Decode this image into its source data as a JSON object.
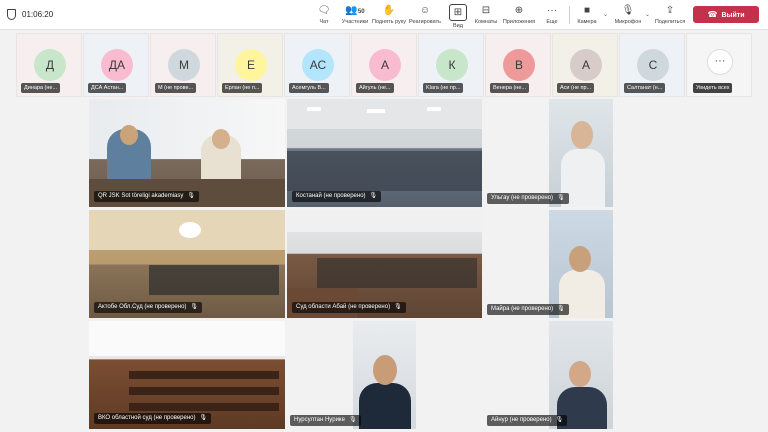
{
  "toolbar": {
    "timer": "01:06:20",
    "chat_label": "Чат",
    "participants_label": "Участники",
    "participants_count": "50",
    "raise_hand_label": "Поднять руку",
    "react_label": "Реагировать",
    "view_label": "Вид",
    "rooms_label": "Комнаты",
    "apps_label": "Приложения",
    "more_label": "Еще",
    "camera_label": "Камера",
    "mic_label": "Микрофон",
    "share_label": "Поделиться",
    "leave_label": "Выйти"
  },
  "strip": [
    {
      "initials": "Д",
      "name": "Динара (не...",
      "color": "#c8e6c9"
    },
    {
      "initials": "ДА",
      "name": "ДСА Астан...",
      "color": "#f8bbd0"
    },
    {
      "initials": "М",
      "name": "М (не прове...",
      "color": "#cfd8dc"
    },
    {
      "initials": "Е",
      "name": "Ерлан (не п...",
      "color": "#fff59d"
    },
    {
      "initials": "АС",
      "name": "Асемгуль В...",
      "color": "#b3e5fc"
    },
    {
      "initials": "А",
      "name": "Айгуль (не...",
      "color": "#f8bbd0"
    },
    {
      "initials": "К",
      "name": "Klara (не пр...",
      "color": "#c8e6c9"
    },
    {
      "initials": "В",
      "name": "Венера (не...",
      "color": "#ef9a9a"
    },
    {
      "initials": "А",
      "name": "Аси (не пр...",
      "color": "#d7ccc8"
    },
    {
      "initials": "С",
      "name": "Салтанат (н...",
      "color": "#cfd8dc"
    }
  ],
  "see_all_label": "Увидеть всех",
  "tiles": {
    "t1": "QR JSK Sot töreligi akademiasy",
    "t2": "Костанай (не проверено)",
    "t3": "Ульгау (не проверено)",
    "t4": "Актобе Обл.Суд (не проверено)",
    "t5": "Суд области Абай (не проверено)",
    "t6": "Майра (не проверено)",
    "t7": "ВКО областной суд (не проверено)",
    "t8": "Нурсултан Нурике",
    "t9": "Айнур (не проверено)"
  },
  "colors": {
    "accent": "#c4314b",
    "toolbar_bg": "#ffffff",
    "stage_bg": "#f2f2f2"
  }
}
